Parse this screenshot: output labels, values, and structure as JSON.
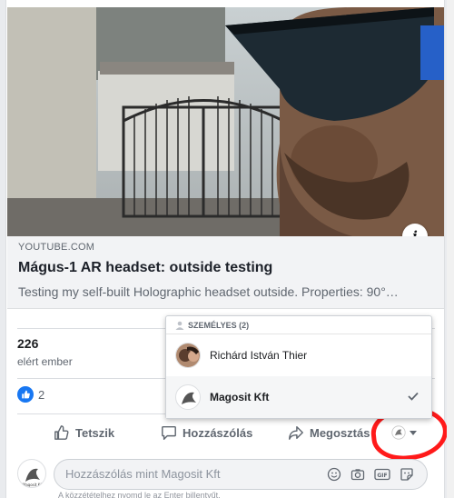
{
  "link_preview": {
    "domain": "YOUTUBE.COM",
    "title": "Mágus-1 AR headset: outside testing",
    "description": "Testing my self-built Holographic headset outside. Properties: 90°…",
    "info_glyph": "i"
  },
  "reach": {
    "count": "226",
    "label": "elért ember"
  },
  "reactions": {
    "like_count": "2"
  },
  "actions": {
    "like": "Tetszik",
    "comment": "Hozzászólás",
    "share": "Megosztás"
  },
  "actor_dropdown": {
    "section_header": "SZEMÉLYES (2)",
    "items": [
      {
        "name": "Richárd István Thier",
        "selected": false
      },
      {
        "name": "Magosit Kft",
        "selected": true
      }
    ]
  },
  "comment_box": {
    "placeholder": "Hozzászólás mint Magosit Kft",
    "hint": "A közzétételhez nyomd le az Enter billentyűt."
  },
  "colors": {
    "facebook_blue": "#1877f2",
    "annotation_red": "#ff1a1a",
    "link_bg": "#f2f3f5"
  },
  "icons": [
    "info-icon",
    "like-icon",
    "comment-icon",
    "share-icon",
    "person-icon",
    "check-icon",
    "emoji-icon",
    "camera-icon",
    "gif-icon",
    "sticker-icon",
    "caret-down-icon"
  ]
}
